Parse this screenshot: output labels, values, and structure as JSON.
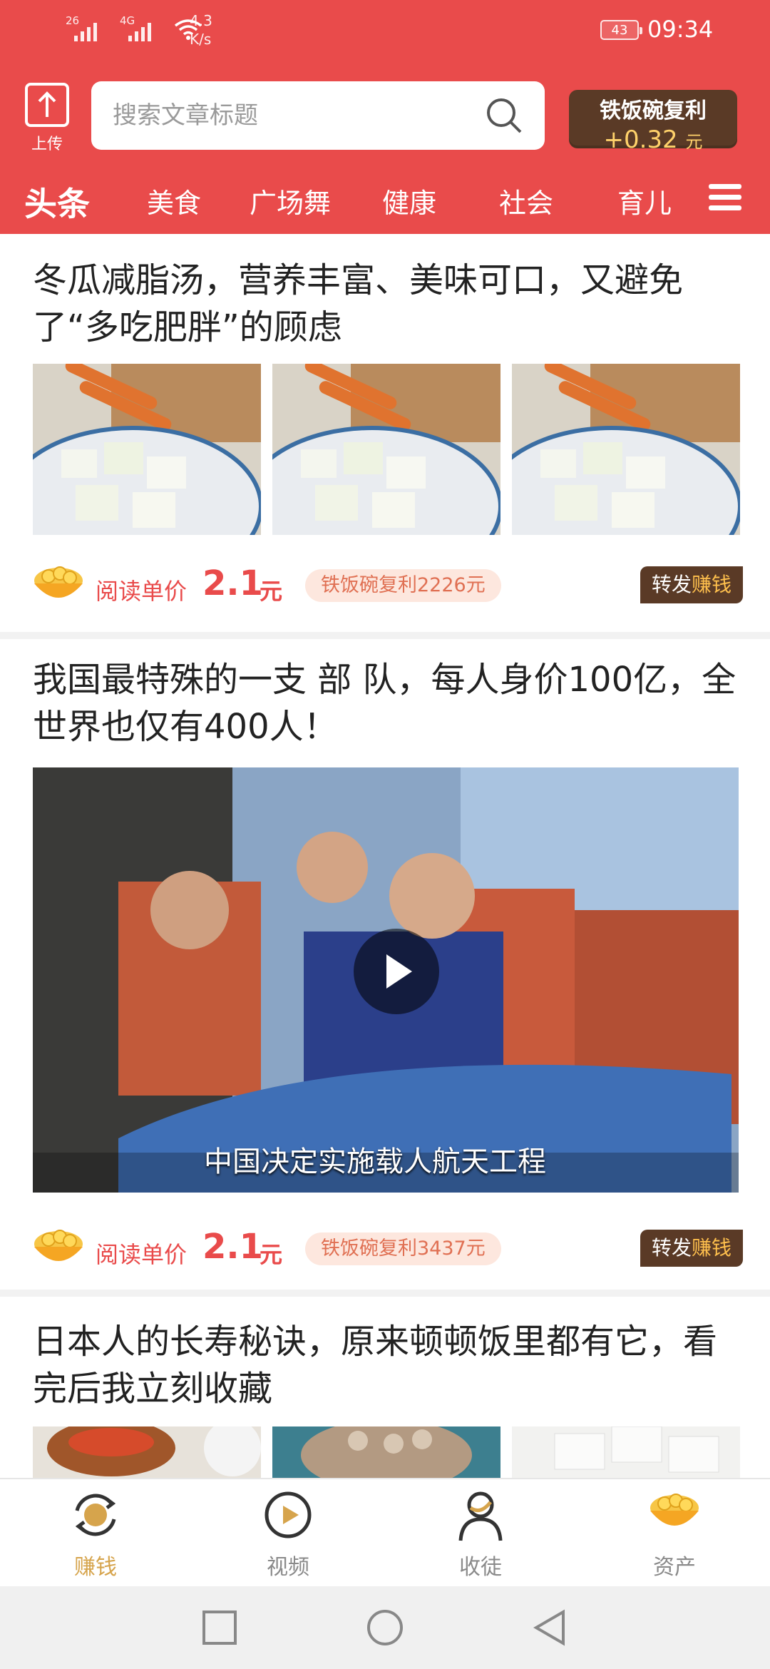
{
  "status_bar": {
    "sim1": "26",
    "sim2": "4G",
    "speed_value": "4.3",
    "speed_unit": "K/s",
    "battery": "43",
    "time": "09:34"
  },
  "header": {
    "upload_label": "上传",
    "search_placeholder": "搜索文章标题",
    "bonus_title": "铁饭碗复利",
    "bonus_amount": "+0.32",
    "bonus_unit": "元"
  },
  "tabs": [
    {
      "label": "头条",
      "active": true
    },
    {
      "label": "美食",
      "active": false
    },
    {
      "label": "广场舞",
      "active": false
    },
    {
      "label": "健康",
      "active": false
    },
    {
      "label": "社会",
      "active": false
    },
    {
      "label": "育儿",
      "active": false
    }
  ],
  "feed": [
    {
      "title": "冬瓜减脂汤，营养丰富、美味可口，又避免了“多吃肥胖”的顾虑",
      "read_price_label": "阅读单价",
      "read_price_value": "2.1",
      "read_price_unit": "元",
      "pill": "铁饭碗复利2226元",
      "share_label": "转发",
      "share_earn": "赚钱"
    },
    {
      "title": "我国最特殊的一支 部 队，每人身价100亿，全世界也仅有400人！",
      "video_caption": "中国决定实施载人航天工程",
      "read_price_label": "阅读单价",
      "read_price_value": "2.1",
      "read_price_unit": "元",
      "pill": "铁饭碗复利3437元",
      "share_label": "转发",
      "share_earn": "赚钱"
    },
    {
      "title": "日本人的长寿秘诀，原来顿顿饭里都有它，看完后我立刻收藏"
    }
  ],
  "bottom_nav": [
    {
      "label": "赚钱",
      "icon": "refresh-coin-icon",
      "active": true
    },
    {
      "label": "视频",
      "icon": "play-circle-icon",
      "active": false
    },
    {
      "label": "收徒",
      "icon": "person-icon",
      "active": false
    },
    {
      "label": "资产",
      "icon": "gold-bowl-icon",
      "active": false
    }
  ],
  "colors": {
    "header_red": "#e94b4b",
    "brown": "#5a3a26",
    "gold": "#d6a44c"
  }
}
